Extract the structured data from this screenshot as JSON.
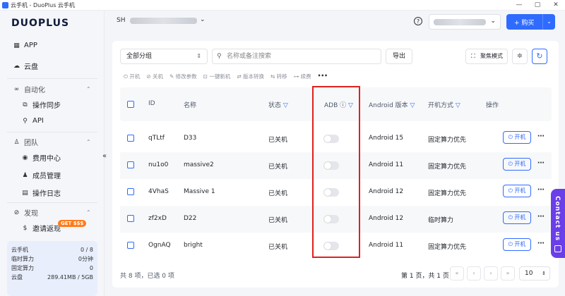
{
  "window": {
    "title": "云手机 - DuoPlus 云手机",
    "controls": [
      "—",
      "▢",
      "✕"
    ]
  },
  "sidebar": {
    "logo": "DUOPLUS",
    "items": [
      {
        "label": "APP",
        "icon": "grid-icon"
      },
      {
        "label": "云盘",
        "icon": "cloud-icon"
      }
    ],
    "groups": [
      {
        "label": "自动化",
        "icon": "link-icon",
        "children": [
          {
            "label": "操作同步",
            "icon": "sync-icon"
          },
          {
            "label": "API",
            "icon": "api-icon"
          }
        ]
      },
      {
        "label": "团队",
        "icon": "team-icon",
        "children": [
          {
            "label": "费用中心",
            "icon": "money-icon"
          },
          {
            "label": "成员管理",
            "icon": "members-icon"
          },
          {
            "label": "操作日志",
            "icon": "log-icon"
          }
        ]
      },
      {
        "label": "发现",
        "icon": "compass-icon",
        "children": [
          {
            "label": "邀请返现",
            "icon": "dollar-icon"
          }
        ]
      }
    ],
    "get_badge": "GET $$$",
    "usage": [
      {
        "label": "云手机",
        "value": "0 / 8"
      },
      {
        "label": "临时算力",
        "value": "0分钟"
      },
      {
        "label": "固定算力",
        "value": "0"
      },
      {
        "label": "云盘",
        "value": "289.41MB / 5GB"
      }
    ],
    "collapse_glyph": "«"
  },
  "topbar": {
    "account_initials": "SH",
    "buy_label": "+ 购买",
    "help_glyph": "?"
  },
  "toolbar": {
    "group_select": "全部分组",
    "search_placeholder": "名称或备注搜索",
    "export_label": "导出",
    "focus_label": "聚焦模式"
  },
  "actions": [
    {
      "icon": "power-icon",
      "label": "⏻ 开机"
    },
    {
      "icon": "power-off-icon",
      "label": "⊘ 关机"
    },
    {
      "icon": "edit-icon",
      "label": "✎ 修改参数"
    },
    {
      "icon": "new-icon",
      "label": "⊡ 一键新机"
    },
    {
      "icon": "version-icon",
      "label": "⇄ 版本转换"
    },
    {
      "icon": "transfer-icon",
      "label": "⇆ 转移"
    },
    {
      "icon": "renew-icon",
      "label": "⊶ 续费"
    },
    {
      "icon": "more-icon",
      "label": "•••"
    }
  ],
  "table": {
    "headers": {
      "id": "ID",
      "name": "名称",
      "status": "状态",
      "adb": "ADB",
      "android": "Android 版本",
      "boot_mode": "开机方式",
      "ops": "操作"
    },
    "rows": [
      {
        "id": "qTLtf",
        "name": "D33",
        "status": "已关机",
        "adb": false,
        "android": "Android 15",
        "boot_mode": "固定算力优先",
        "boot_label": "⏻ 开机"
      },
      {
        "id": "nu1o0",
        "name": "massive2",
        "status": "已关机",
        "adb": false,
        "android": "Android 11",
        "boot_mode": "固定算力优先",
        "boot_label": "⏻ 开机"
      },
      {
        "id": "4VhaS",
        "name": "Massive 1",
        "status": "已关机",
        "adb": false,
        "android": "Android 12",
        "boot_mode": "固定算力优先",
        "boot_label": "⏻ 开机"
      },
      {
        "id": "zf2xD",
        "name": "D22",
        "status": "已关机",
        "adb": false,
        "android": "Android 12",
        "boot_mode": "临时算力",
        "boot_label": "⏻ 开机"
      },
      {
        "id": "OgnAQ",
        "name": "bright",
        "status": "已关机",
        "adb": false,
        "android": "Android 11",
        "boot_mode": "固定算力优先",
        "boot_label": "⏻ 开机"
      }
    ]
  },
  "footer": {
    "summary": "共 8 项，已选 0 项",
    "page_info": "第 1 页，共 1 页",
    "page_size": "10",
    "nav": [
      "«",
      "‹",
      "›",
      "»"
    ]
  },
  "contact_label": "Contact us",
  "colors": {
    "accent": "#2f6bff",
    "highlight": "#e02020",
    "contact": "#6a3ee8"
  }
}
